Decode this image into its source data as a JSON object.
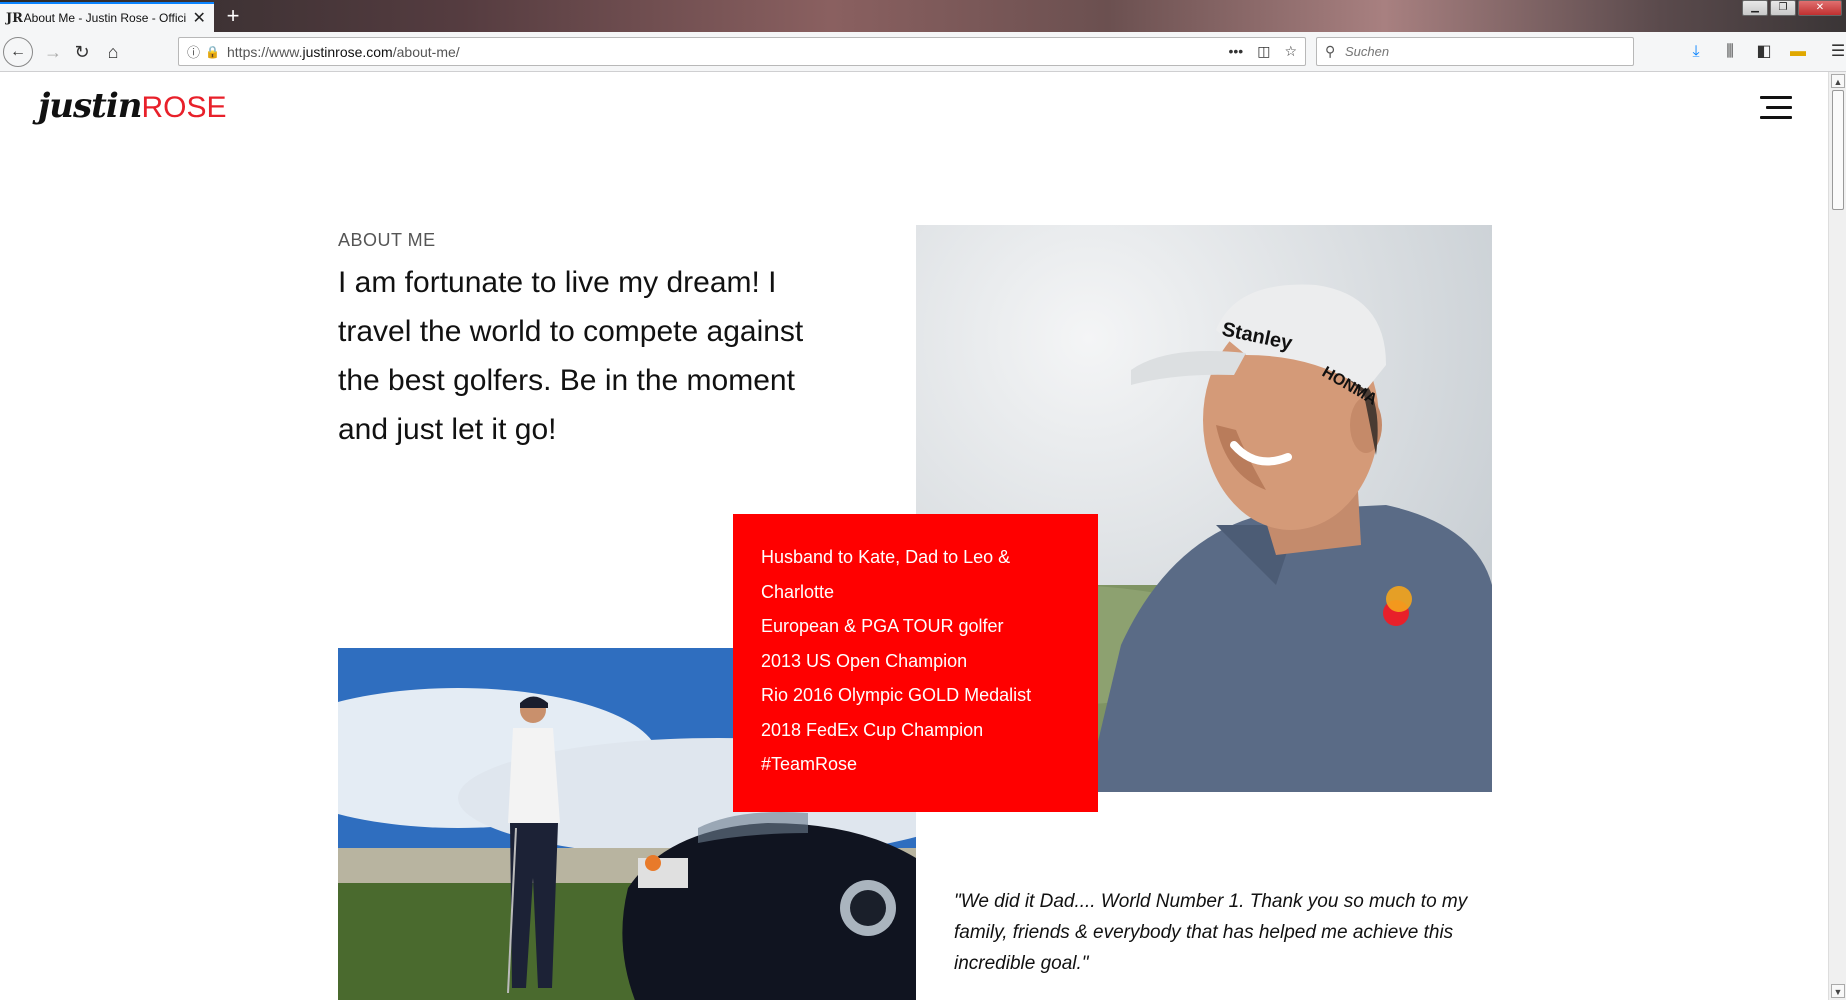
{
  "browser": {
    "tab_title": "About Me - Justin Rose - Offici",
    "tab_favicon": "JR",
    "tab_close": "✕",
    "new_tab": "+",
    "url_prefix": "https://www.",
    "url_domain": "justinrose.com",
    "url_path": "/about-me/",
    "search_placeholder": "Suchen"
  },
  "site": {
    "logo_justin": "justin",
    "logo_rose": "ROSE",
    "section_label": "ABOUT ME",
    "headline": "I am fortunate to live my dream! I travel the world to compete against the best golfers. Be in the moment and just let it go!",
    "facts": [
      "Husband to Kate, Dad to Leo & Charlotte",
      "European & PGA TOUR golfer",
      "2013 US Open Champion",
      "Rio 2016 Olympic GOLD Medalist",
      "2018 FedEx Cup Champion",
      "#TeamRose"
    ],
    "quote": "\"We did it Dad.... World Number 1. Thank you so much to my family, friends & everybody that has helped me achieve this incredible goal.\""
  },
  "photo_captions": {
    "cap_brand": "Stanley",
    "cap_logo": "HONMA"
  },
  "colors": {
    "accent_red": "#ff0000",
    "logo_red": "#e8202a",
    "text_dark": "#111111"
  }
}
